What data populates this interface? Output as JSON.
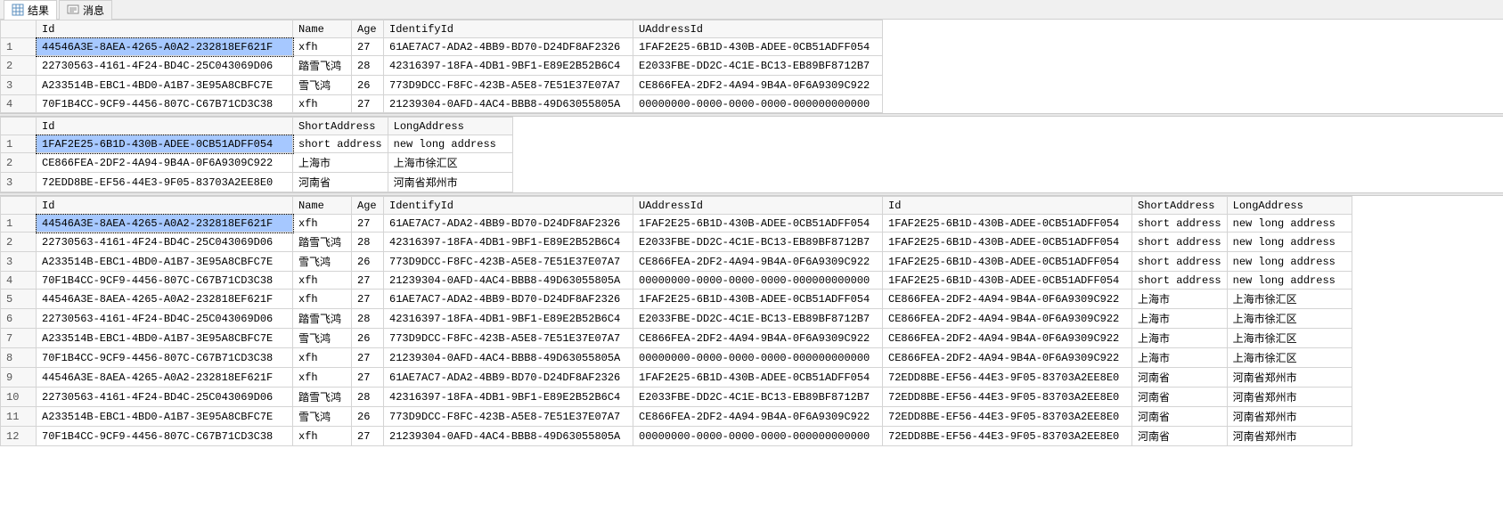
{
  "tabs": {
    "results": "结果",
    "messages": "消息"
  },
  "grid1": {
    "headers": [
      "Id",
      "Name",
      "Age",
      "IdentifyId",
      "UAddressId"
    ],
    "rows": [
      [
        "44546A3E-8AEA-4265-A0A2-232818EF621F",
        "xfh",
        "27",
        "61AE7AC7-ADA2-4BB9-BD70-D24DF8AF2326",
        "1FAF2E25-6B1D-430B-ADEE-0CB51ADFF054"
      ],
      [
        "22730563-4161-4F24-BD4C-25C043069D06",
        "踏雪飞鸿",
        "28",
        "42316397-18FA-4DB1-9BF1-E89E2B52B6C4",
        "E2033FBE-DD2C-4C1E-BC13-EB89BF8712B7"
      ],
      [
        "A233514B-EBC1-4BD0-A1B7-3E95A8CBFC7E",
        "雪飞鸿",
        "26",
        "773D9DCC-F8FC-423B-A5E8-7E51E37E07A7",
        "CE866FEA-2DF2-4A94-9B4A-0F6A9309C922"
      ],
      [
        "70F1B4CC-9CF9-4456-807C-C67B71CD3C38",
        "xfh",
        "27",
        "21239304-0AFD-4AC4-BBB8-49D63055805A",
        "00000000-0000-0000-0000-000000000000"
      ]
    ],
    "widths": [
      288,
      66,
      36,
      280,
      280
    ]
  },
  "grid2": {
    "headers": [
      "Id",
      "ShortAddress",
      "LongAddress"
    ],
    "rows": [
      [
        "1FAF2E25-6B1D-430B-ADEE-0CB51ADFF054",
        "short address",
        "new long address"
      ],
      [
        "CE866FEA-2DF2-4A94-9B4A-0F6A9309C922",
        "上海市",
        "上海市徐汇区"
      ],
      [
        "72EDD8BE-EF56-44E3-9F05-83703A2EE8E0",
        "河南省",
        "河南省郑州市"
      ]
    ],
    "widths": [
      288,
      102,
      140
    ]
  },
  "grid3": {
    "headers": [
      "Id",
      "Name",
      "Age",
      "IdentifyId",
      "UAddressId",
      "Id",
      "ShortAddress",
      "LongAddress"
    ],
    "rows": [
      [
        "44546A3E-8AEA-4265-A0A2-232818EF621F",
        "xfh",
        "27",
        "61AE7AC7-ADA2-4BB9-BD70-D24DF8AF2326",
        "1FAF2E25-6B1D-430B-ADEE-0CB51ADFF054",
        "1FAF2E25-6B1D-430B-ADEE-0CB51ADFF054",
        "short address",
        "new long address"
      ],
      [
        "22730563-4161-4F24-BD4C-25C043069D06",
        "踏雪飞鸿",
        "28",
        "42316397-18FA-4DB1-9BF1-E89E2B52B6C4",
        "E2033FBE-DD2C-4C1E-BC13-EB89BF8712B7",
        "1FAF2E25-6B1D-430B-ADEE-0CB51ADFF054",
        "short address",
        "new long address"
      ],
      [
        "A233514B-EBC1-4BD0-A1B7-3E95A8CBFC7E",
        "雪飞鸿",
        "26",
        "773D9DCC-F8FC-423B-A5E8-7E51E37E07A7",
        "CE866FEA-2DF2-4A94-9B4A-0F6A9309C922",
        "1FAF2E25-6B1D-430B-ADEE-0CB51ADFF054",
        "short address",
        "new long address"
      ],
      [
        "70F1B4CC-9CF9-4456-807C-C67B71CD3C38",
        "xfh",
        "27",
        "21239304-0AFD-4AC4-BBB8-49D63055805A",
        "00000000-0000-0000-0000-000000000000",
        "1FAF2E25-6B1D-430B-ADEE-0CB51ADFF054",
        "short address",
        "new long address"
      ],
      [
        "44546A3E-8AEA-4265-A0A2-232818EF621F",
        "xfh",
        "27",
        "61AE7AC7-ADA2-4BB9-BD70-D24DF8AF2326",
        "1FAF2E25-6B1D-430B-ADEE-0CB51ADFF054",
        "CE866FEA-2DF2-4A94-9B4A-0F6A9309C922",
        "上海市",
        "上海市徐汇区"
      ],
      [
        "22730563-4161-4F24-BD4C-25C043069D06",
        "踏雪飞鸿",
        "28",
        "42316397-18FA-4DB1-9BF1-E89E2B52B6C4",
        "E2033FBE-DD2C-4C1E-BC13-EB89BF8712B7",
        "CE866FEA-2DF2-4A94-9B4A-0F6A9309C922",
        "上海市",
        "上海市徐汇区"
      ],
      [
        "A233514B-EBC1-4BD0-A1B7-3E95A8CBFC7E",
        "雪飞鸿",
        "26",
        "773D9DCC-F8FC-423B-A5E8-7E51E37E07A7",
        "CE866FEA-2DF2-4A94-9B4A-0F6A9309C922",
        "CE866FEA-2DF2-4A94-9B4A-0F6A9309C922",
        "上海市",
        "上海市徐汇区"
      ],
      [
        "70F1B4CC-9CF9-4456-807C-C67B71CD3C38",
        "xfh",
        "27",
        "21239304-0AFD-4AC4-BBB8-49D63055805A",
        "00000000-0000-0000-0000-000000000000",
        "CE866FEA-2DF2-4A94-9B4A-0F6A9309C922",
        "上海市",
        "上海市徐汇区"
      ],
      [
        "44546A3E-8AEA-4265-A0A2-232818EF621F",
        "xfh",
        "27",
        "61AE7AC7-ADA2-4BB9-BD70-D24DF8AF2326",
        "1FAF2E25-6B1D-430B-ADEE-0CB51ADFF054",
        "72EDD8BE-EF56-44E3-9F05-83703A2EE8E0",
        "河南省",
        "河南省郑州市"
      ],
      [
        "22730563-4161-4F24-BD4C-25C043069D06",
        "踏雪飞鸿",
        "28",
        "42316397-18FA-4DB1-9BF1-E89E2B52B6C4",
        "E2033FBE-DD2C-4C1E-BC13-EB89BF8712B7",
        "72EDD8BE-EF56-44E3-9F05-83703A2EE8E0",
        "河南省",
        "河南省郑州市"
      ],
      [
        "A233514B-EBC1-4BD0-A1B7-3E95A8CBFC7E",
        "雪飞鸿",
        "26",
        "773D9DCC-F8FC-423B-A5E8-7E51E37E07A7",
        "CE866FEA-2DF2-4A94-9B4A-0F6A9309C922",
        "72EDD8BE-EF56-44E3-9F05-83703A2EE8E0",
        "河南省",
        "河南省郑州市"
      ],
      [
        "70F1B4CC-9CF9-4456-807C-C67B71CD3C38",
        "xfh",
        "27",
        "21239304-0AFD-4AC4-BBB8-49D63055805A",
        "00000000-0000-0000-0000-000000000000",
        "72EDD8BE-EF56-44E3-9F05-83703A2EE8E0",
        "河南省",
        "河南省郑州市"
      ]
    ],
    "widths": [
      288,
      66,
      36,
      280,
      280,
      280,
      106,
      140
    ]
  }
}
